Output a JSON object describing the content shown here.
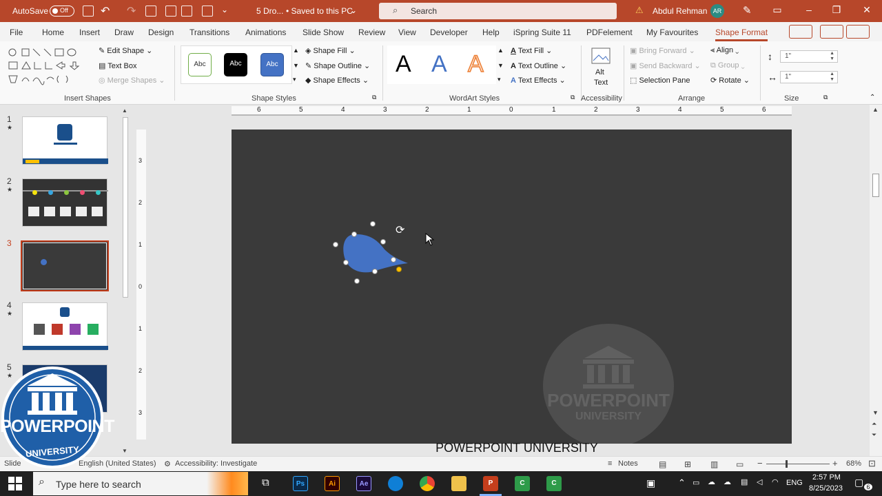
{
  "titlebar": {
    "autosave_label": "AutoSave",
    "autosave_state": "Off",
    "doc_name": "5 Dro...",
    "save_status": "• Saved to this PC",
    "search_placeholder": "Search",
    "user_name": "Abdul Rehman",
    "user_initials": "AR"
  },
  "menu": {
    "tabs": [
      "File",
      "Home",
      "Insert",
      "Draw",
      "Design",
      "Transitions",
      "Animations",
      "Slide Show",
      "Review",
      "View",
      "Developer",
      "Help",
      "iSpring Suite 11",
      "PDFelement",
      "My Favourites",
      "Shape Format"
    ],
    "active_tab": "Shape Format"
  },
  "ribbon": {
    "insert_shapes": {
      "label": "Insert Shapes",
      "edit_shape": "Edit Shape",
      "text_box": "Text Box",
      "merge_shapes": "Merge Shapes"
    },
    "shape_styles": {
      "label": "Shape Styles",
      "samples": [
        "Abc",
        "Abc",
        "Abc"
      ],
      "shape_fill": "Shape Fill",
      "shape_outline": "Shape Outline",
      "shape_effects": "Shape Effects"
    },
    "wordart_styles": {
      "label": "WordArt Styles",
      "samples": [
        "A",
        "A",
        "A"
      ],
      "text_fill": "Text Fill",
      "text_outline": "Text Outline",
      "text_effects": "Text Effects"
    },
    "accessibility": {
      "label": "Accessibility",
      "alt_text_1": "Alt",
      "alt_text_2": "Text"
    },
    "arrange": {
      "label": "Arrange",
      "bring_forward": "Bring Forward",
      "send_backward": "Send Backward",
      "selection_pane": "Selection Pane",
      "align": "Align",
      "group": "Group",
      "rotate": "Rotate"
    },
    "size": {
      "label": "Size",
      "height": "1\"",
      "width": "1\""
    }
  },
  "ruler": {
    "horizontal_ticks": [
      "6",
      "5",
      "4",
      "3",
      "2",
      "1",
      "0",
      "1",
      "2",
      "3",
      "4",
      "5",
      "6"
    ],
    "vertical_ticks": [
      "3",
      "2",
      "1",
      "0",
      "1",
      "2",
      "3"
    ]
  },
  "slides": [
    {
      "number": "1",
      "has_star": true
    },
    {
      "number": "2",
      "has_star": true
    },
    {
      "number": "3",
      "has_star": false,
      "selected": true
    },
    {
      "number": "4",
      "has_star": true
    },
    {
      "number": "5",
      "has_star": true
    }
  ],
  "slide": {
    "watermark_line1": "POWERPOINT",
    "watermark_line2": "UNIVERSITY",
    "shape_color": "#4472c4"
  },
  "caption": "POWERPOINT UNIVERSITY",
  "logo": {
    "line1": "POWERPOINT",
    "line2": "UNIVERSITY"
  },
  "statusbar": {
    "slide_info": "Slide",
    "language": "English (United States)",
    "accessibility": "Accessibility: Investigate",
    "notes": "Notes",
    "zoom": "68%"
  },
  "taskbar": {
    "search_placeholder": "Type here to search",
    "apps": [
      "Ps",
      "Ai",
      "Ae",
      "Edge",
      "Chrome",
      "Files",
      "P",
      "C",
      "C"
    ],
    "language": "ENG",
    "time": "2:57 PM",
    "date": "8/25/2023",
    "notifications": "6"
  },
  "colors": {
    "accent": "#b7472a",
    "slide_bg": "#3a3a3a",
    "shape_blue": "#4472c4"
  }
}
